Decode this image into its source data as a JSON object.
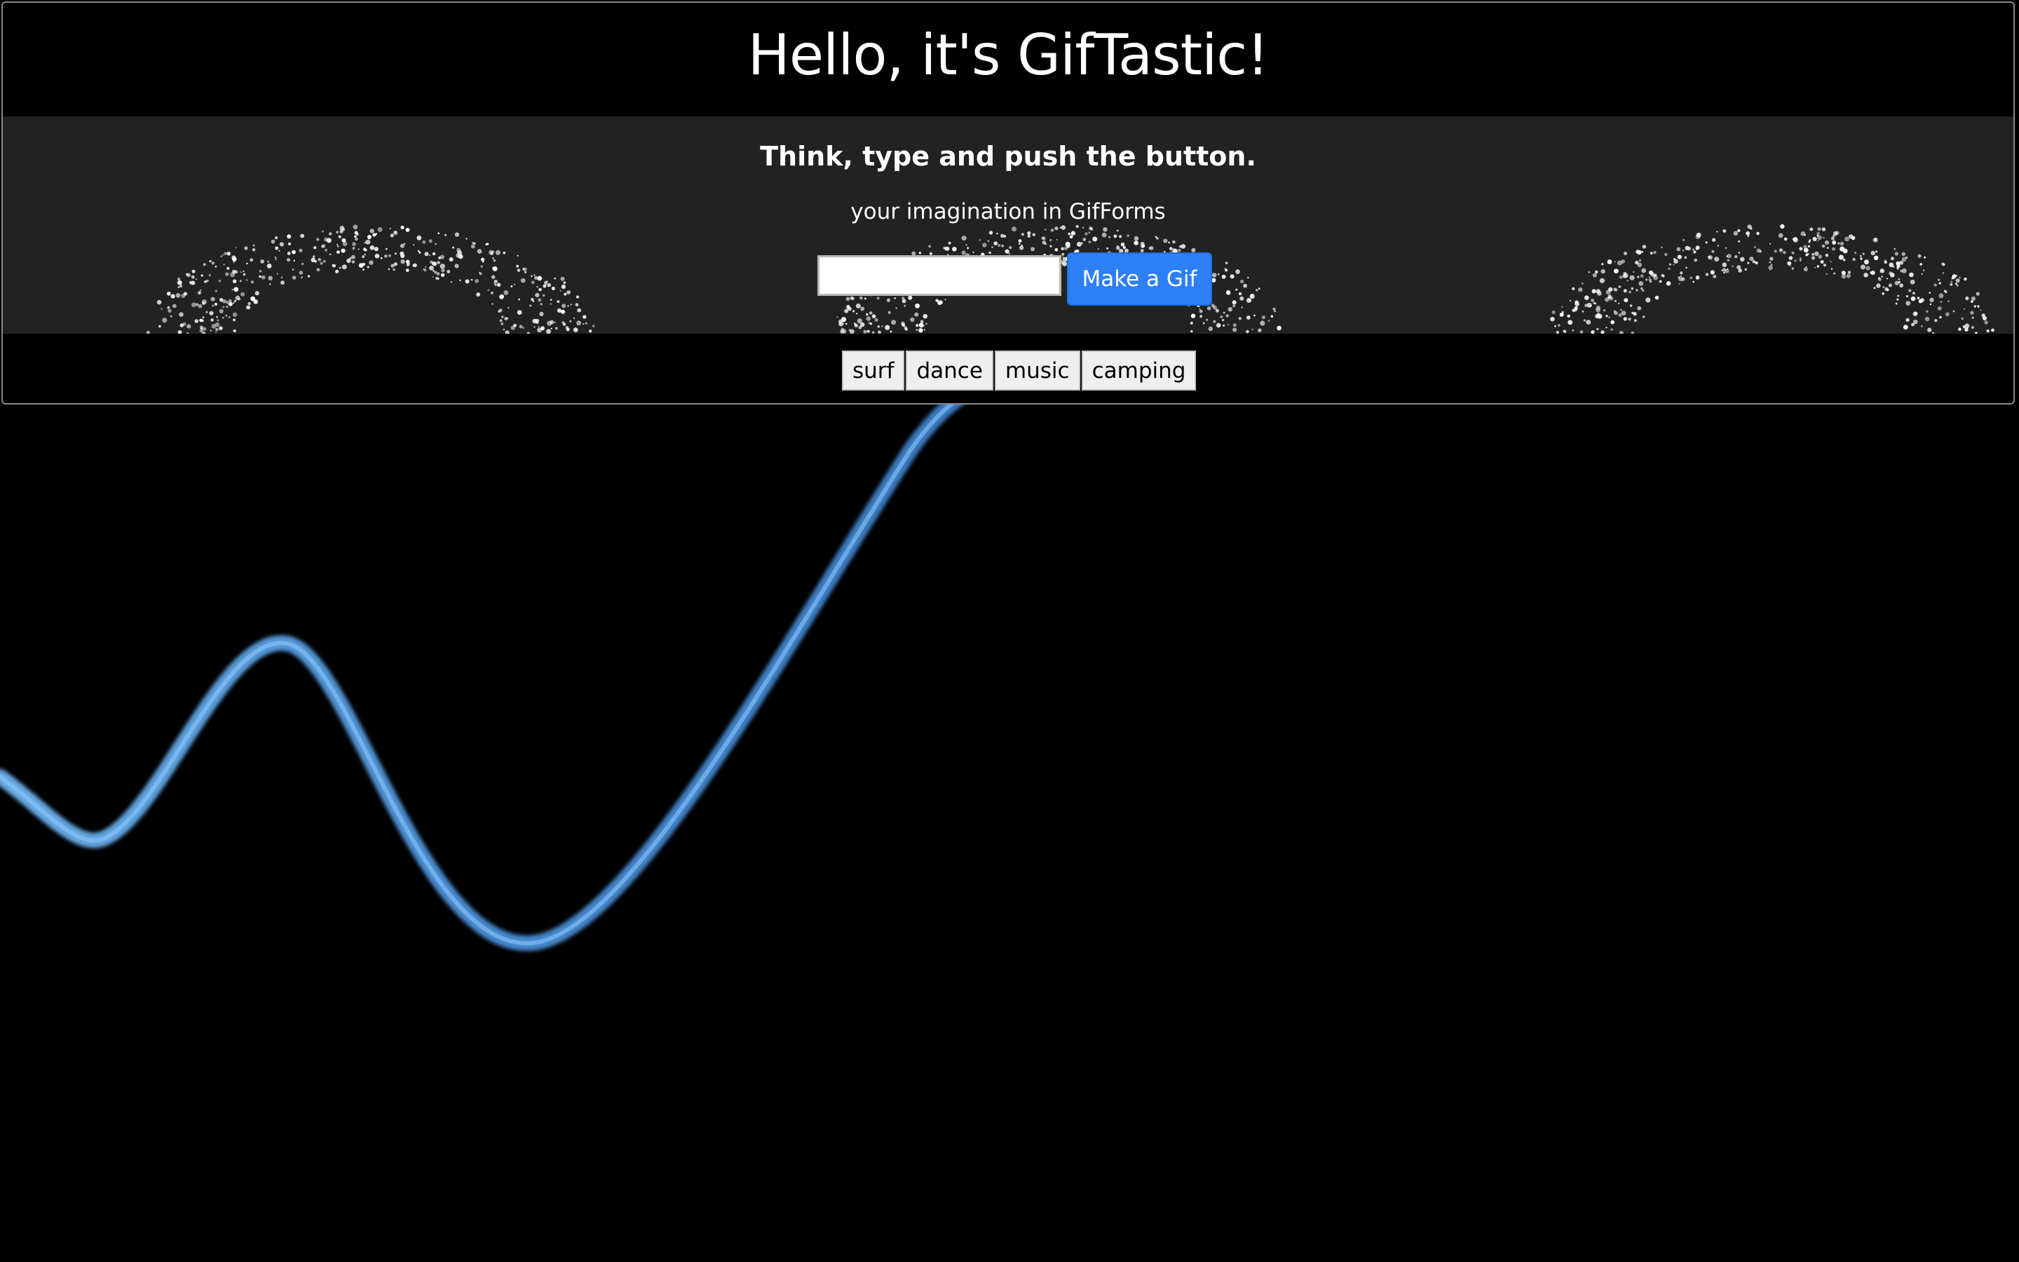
{
  "header": {
    "title": "Hello, it's GifTastic!"
  },
  "panel": {
    "subtitle": "Think, type and push the button.",
    "tagline": "your imagination in GifForms"
  },
  "search": {
    "value": "",
    "placeholder": ""
  },
  "make_gif_button": {
    "label": "Make a Gif",
    "color": "#2d7ff7"
  },
  "topics": [
    {
      "label": "surf"
    },
    {
      "label": "dance"
    },
    {
      "label": "music"
    },
    {
      "label": "camping"
    }
  ],
  "colors": {
    "page_background": "#000000",
    "panel_background": "#222222",
    "wave": "#4a90d9",
    "ring_glow": "#e040e8"
  }
}
